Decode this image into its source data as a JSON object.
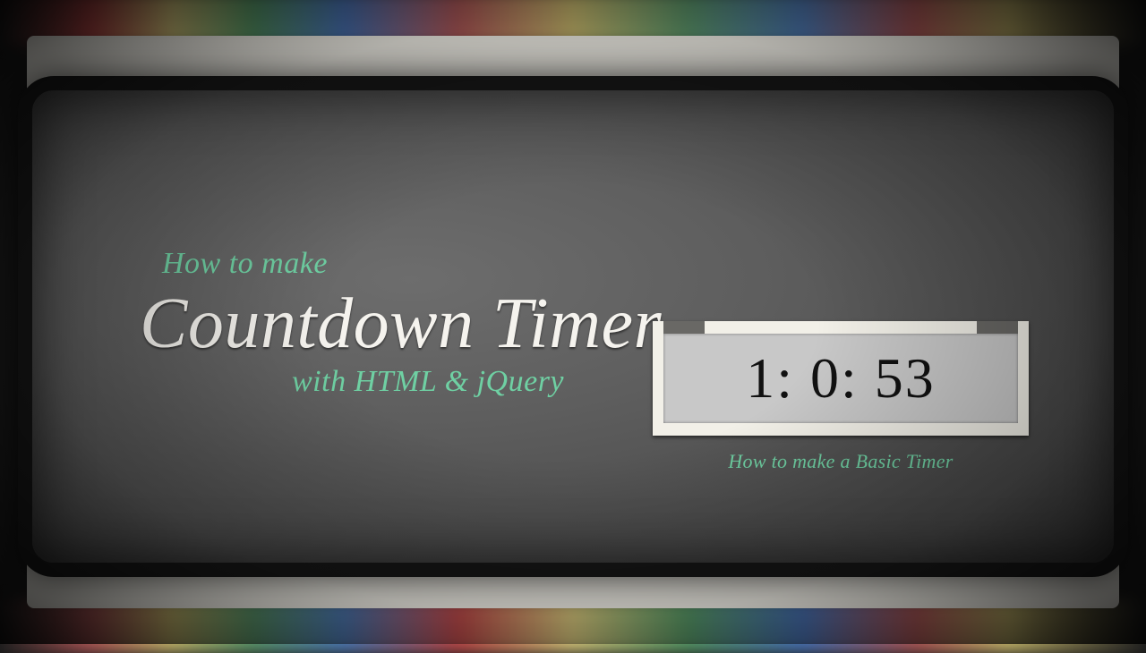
{
  "kicker": "How to make",
  "title": "Countdown Timer",
  "subtitle": "with HTML & jQuery",
  "timer": {
    "value": "1: 0: 53",
    "caption": "How to make a Basic Timer"
  },
  "colors": {
    "accent": "#6fd0a3",
    "frameBorder": "#141414",
    "paper": "#f2f0e8"
  }
}
